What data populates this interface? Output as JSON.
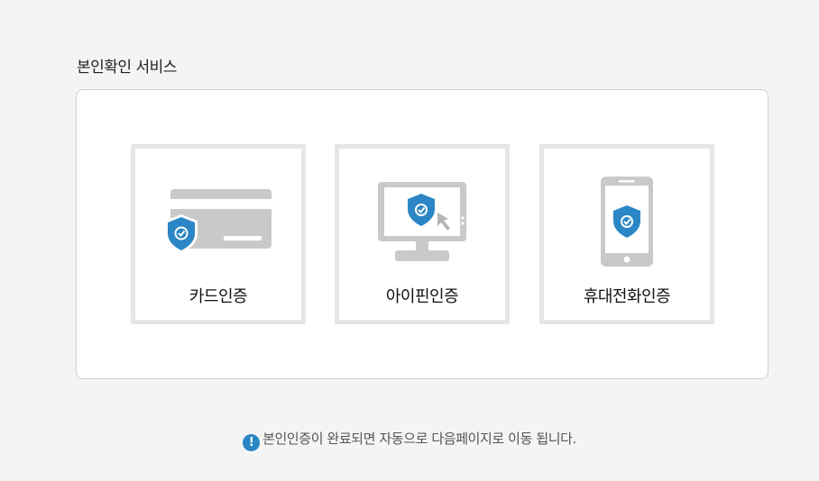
{
  "section": {
    "title": "본인확인 서비스"
  },
  "methods": [
    {
      "label": "카드인증",
      "icon": "credit-card-shield-icon"
    },
    {
      "label": "아이핀인증",
      "icon": "monitor-shield-icon"
    },
    {
      "label": "휴대전화인증",
      "icon": "mobile-phone-shield-icon"
    }
  ],
  "notice": {
    "icon": "exclamation-circle-icon",
    "text": "본인인증이 완료되면 자동으로 다음페이지로 이동 됩니다."
  },
  "colors": {
    "accent": "#2b86c5",
    "icon_gray": "#c9c9c9",
    "card_border": "#e6e6e6"
  }
}
